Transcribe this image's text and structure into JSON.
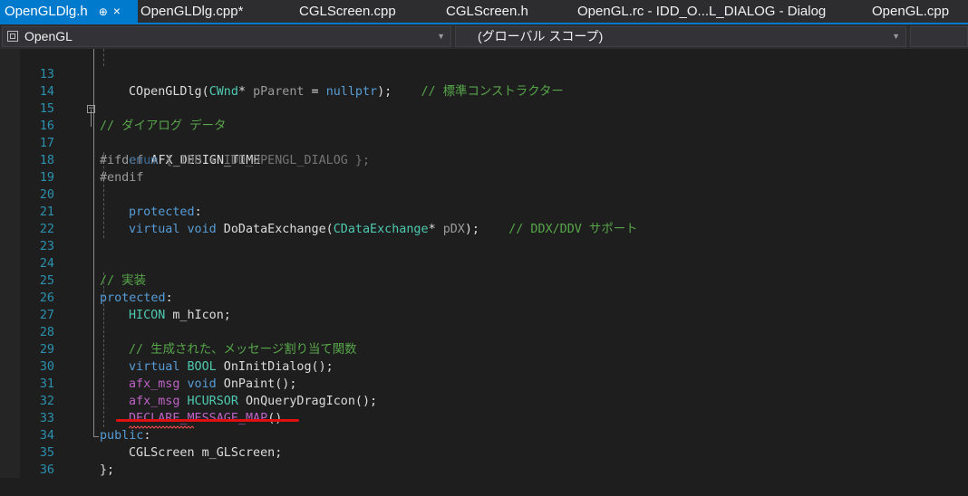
{
  "tabs": [
    {
      "label": "OpenGLDlg.h",
      "active": true,
      "pin": "⊕",
      "close": "×"
    },
    {
      "label": "OpenGLDlg.cpp*"
    },
    {
      "label": "CGLScreen.cpp"
    },
    {
      "label": "CGLScreen.h"
    },
    {
      "label": "OpenGL.rc - IDD_O...L_DIALOG - Dialog"
    },
    {
      "label": "OpenGL.cpp"
    }
  ],
  "navbar": {
    "project": "OpenGL",
    "scope": "(グローバル スコープ)"
  },
  "code": {
    "l13": {
      "n": "13",
      "a": "COpenGLDlg(",
      "b": "CWnd",
      "c": "* ",
      "d": "pParent",
      "e": " = ",
      "f": "nullptr",
      "g": ");    ",
      "h": "// 標準コンストラクター"
    },
    "l14": {
      "n": "14"
    },
    "l15": {
      "n": "15",
      "a": "// ダイアログ データ"
    },
    "l16": {
      "n": "16",
      "a": "#ifdef",
      "b": " AFX_DESIGN_TIME"
    },
    "l17": {
      "n": "17",
      "a": "enum",
      "b": " { IDD = IDD_OPENGL_DIALOG };"
    },
    "l18": {
      "n": "18",
      "a": "#endif"
    },
    "l19": {
      "n": "19"
    },
    "l20": {
      "n": "20",
      "a": "protected",
      "b": ":"
    },
    "l21": {
      "n": "21",
      "a": "virtual",
      "b": " ",
      "c": "void",
      "d": " DoDataExchange(",
      "e": "CDataExchange",
      "f": "* ",
      "g": "pDX",
      "h": ");    ",
      "i": "// DDX/DDV サポート"
    },
    "l22": {
      "n": "22"
    },
    "l23": {
      "n": "23"
    },
    "l24": {
      "n": "24",
      "a": "// 実装"
    },
    "l25": {
      "n": "25",
      "a": "protected",
      "b": ":"
    },
    "l26": {
      "n": "26",
      "a": "HICON",
      "b": " m_hIcon;"
    },
    "l27": {
      "n": "27"
    },
    "l28": {
      "n": "28",
      "a": "// 生成された、メッセージ割り当て関数"
    },
    "l29": {
      "n": "29",
      "a": "virtual",
      "b": " ",
      "c": "BOOL",
      "d": " OnInitDialog();"
    },
    "l30": {
      "n": "30",
      "a": "afx_msg",
      "b": " ",
      "c": "void",
      "d": " OnPaint();"
    },
    "l31": {
      "n": "31",
      "a": "afx_msg",
      "b": " ",
      "c": "HCURSOR",
      "d": " OnQueryDragIcon();"
    },
    "l32": {
      "n": "32",
      "a": "DECLARE_MESSAGE_MAP",
      "b": "()"
    },
    "l33": {
      "n": "33",
      "a": "public",
      "b": ":"
    },
    "l34": {
      "n": "34",
      "a": "CGLScreen",
      "b": " m_GLScreen;"
    },
    "l35": {
      "n": "35",
      "a": "};"
    },
    "l36": {
      "n": "36"
    }
  },
  "colors": {
    "accent": "#007acc",
    "annotation_underline": "#e01010"
  }
}
